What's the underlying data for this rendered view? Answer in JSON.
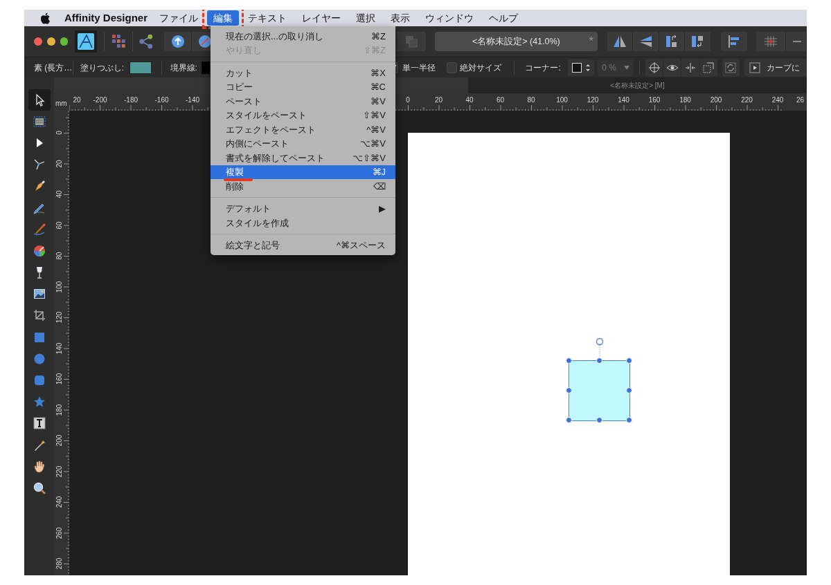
{
  "menu_bar": {
    "app_name": "Affinity Designer",
    "items": [
      {
        "label": "ファイル",
        "selected": false
      },
      {
        "label": "編集",
        "selected": true
      },
      {
        "label": "テキスト",
        "selected": false
      },
      {
        "label": "レイヤー",
        "selected": false
      },
      {
        "label": "選択",
        "selected": false
      },
      {
        "label": "表示",
        "selected": false
      },
      {
        "label": "ウィンドウ",
        "selected": false
      },
      {
        "label": "ヘルプ",
        "selected": false
      }
    ]
  },
  "toolbar": {
    "document_title": "<名称未設定> (41.0%)",
    "modified_mark": "*"
  },
  "context_toolbar": {
    "shape_label": "素 (長方…",
    "fill_label": "塗りつぶし:",
    "stroke_label": "境界線:",
    "single_radius": {
      "label": "単一半径",
      "checked": true
    },
    "absolute_size": {
      "label": "絶対サイズ",
      "checked": false
    },
    "corner_label": "コーナー:",
    "corner_amount": "0 %",
    "curve_button": "カーブに"
  },
  "document_tab": "<名称未設定> [M]",
  "ruler": {
    "unit": "mm",
    "top_left_labels": [
      "20",
      "-200",
      "-180",
      "-160",
      "-140"
    ],
    "top_right_labels": [
      "0",
      "20",
      "40",
      "60",
      "80",
      "100",
      "120",
      "140",
      "160",
      "180",
      "200",
      "220",
      "240",
      "26"
    ],
    "left_labels": [
      "0",
      "20",
      "40",
      "60",
      "80",
      "100",
      "120",
      "140",
      "160",
      "180",
      "200",
      "220",
      "240",
      "260",
      "280"
    ]
  },
  "tools": [
    {
      "kind": "move",
      "selected": true
    },
    {
      "kind": "artboard",
      "selected": false
    },
    {
      "kind": "node",
      "selected": false
    },
    {
      "kind": "corner",
      "selected": false
    },
    {
      "kind": "pen",
      "selected": false
    },
    {
      "kind": "pencil",
      "selected": false
    },
    {
      "kind": "brush",
      "selected": false
    },
    {
      "kind": "fill",
      "selected": false
    },
    {
      "kind": "transparency",
      "selected": false
    },
    {
      "kind": "place",
      "selected": false
    },
    {
      "kind": "crop",
      "selected": false
    },
    {
      "kind": "rectangle",
      "selected": false
    },
    {
      "kind": "ellipse",
      "selected": false
    },
    {
      "kind": "rounded",
      "selected": false
    },
    {
      "kind": "star",
      "selected": false
    },
    {
      "kind": "text",
      "selected": false
    },
    {
      "kind": "picker",
      "selected": false
    },
    {
      "kind": "hand",
      "selected": false
    },
    {
      "kind": "zoom",
      "selected": false
    }
  ],
  "edit_menu": {
    "items": [
      {
        "kind": "item",
        "label": "現在の選択...の取り消し",
        "shortcut": "⌘Z",
        "disabled": false,
        "selected": false
      },
      {
        "kind": "item",
        "label": "やり直し",
        "shortcut": "⇧⌘Z",
        "disabled": true,
        "selected": false
      },
      {
        "kind": "separator"
      },
      {
        "kind": "item",
        "label": "カット",
        "shortcut": "⌘X",
        "disabled": false,
        "selected": false
      },
      {
        "kind": "item",
        "label": "コピー",
        "shortcut": "⌘C",
        "disabled": false,
        "selected": false
      },
      {
        "kind": "item",
        "label": "ペースト",
        "shortcut": "⌘V",
        "disabled": false,
        "selected": false
      },
      {
        "kind": "item",
        "label": "スタイルをペースト",
        "shortcut": "⇧⌘V",
        "disabled": false,
        "selected": false
      },
      {
        "kind": "item",
        "label": "エフェクトをペースト",
        "shortcut": "^⌘V",
        "disabled": false,
        "selected": false
      },
      {
        "kind": "item",
        "label": "内側にペースト",
        "shortcut": "⌥⌘V",
        "disabled": false,
        "selected": false
      },
      {
        "kind": "item",
        "label": "書式を解除してペースト",
        "shortcut": "⌥⇧⌘V",
        "disabled": false,
        "selected": false
      },
      {
        "kind": "item",
        "label": "複製",
        "shortcut": "⌘J",
        "disabled": false,
        "selected": true
      },
      {
        "kind": "item",
        "label": "削除",
        "shortcut": "⌫",
        "disabled": false,
        "selected": false
      },
      {
        "kind": "separator"
      },
      {
        "kind": "item",
        "label": "デフォルト",
        "shortcut": "▶",
        "disabled": false,
        "selected": false
      },
      {
        "kind": "item",
        "label": "スタイルを作成",
        "disabled": false,
        "selected": false
      },
      {
        "kind": "separator"
      },
      {
        "kind": "item",
        "label": "絵文字と記号",
        "shortcut": "^⌘スペース",
        "disabled": false,
        "selected": false
      }
    ]
  }
}
